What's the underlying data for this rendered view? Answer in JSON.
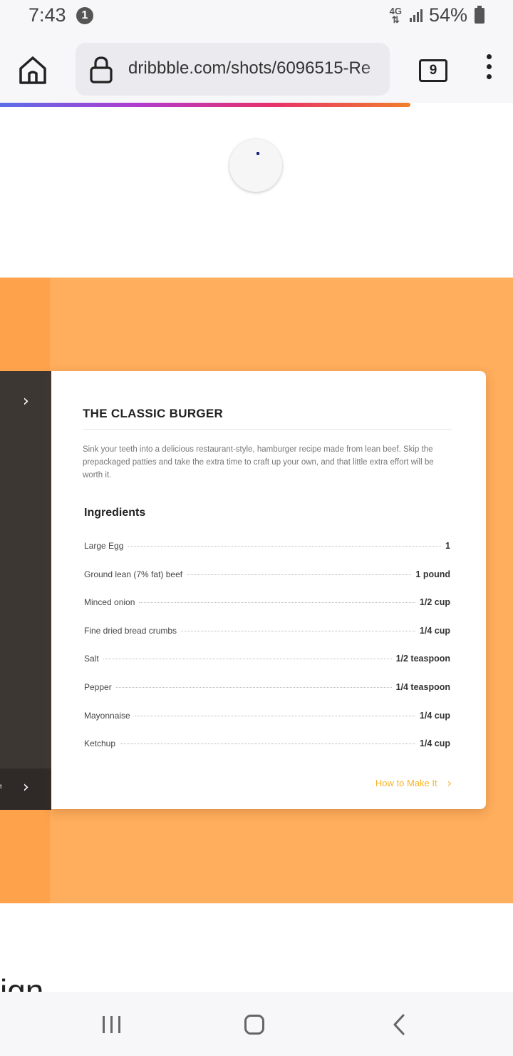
{
  "status_bar": {
    "time": "7:43",
    "notification_count": "1",
    "network_label": "4G",
    "battery": "54%"
  },
  "browser": {
    "url": "dribbble.com/shots/6096515-Re",
    "tab_count": "9",
    "load_progress": 0.8
  },
  "recipe_card": {
    "title": "THE CLASSIC BURGER",
    "description": "Sink your teeth into a delicious restaurant-style, hamburger recipe made from lean beef. Skip the prepackaged patties and take the extra time to craft up your own, and that little extra effort will be worth it.",
    "ingredients_heading": "Ingredients",
    "ingredients": [
      {
        "name": "Large Egg",
        "qty": "1"
      },
      {
        "name": "Ground lean (7% fat) beef",
        "qty": "1 pound"
      },
      {
        "name": "Minced onion",
        "qty": "1/2 cup"
      },
      {
        "name": "Fine dried bread crumbs",
        "qty": "1/4 cup"
      },
      {
        "name": "Salt",
        "qty": "1/2 teaspoon"
      },
      {
        "name": "Pepper",
        "qty": "1/4 teaspoon"
      },
      {
        "name": "Mayonnaise",
        "qty": "1/4 cup"
      },
      {
        "name": "Ketchup",
        "qty": "1/4 cup"
      }
    ],
    "cta_label": "How to Make It"
  },
  "side_panel": {
    "edge_char": "t"
  },
  "page_cut_text": "ign",
  "colors": {
    "accent_orange": "#ffae5d",
    "cta_yellow": "#f7b427",
    "dark_panel": "#3d3734"
  }
}
